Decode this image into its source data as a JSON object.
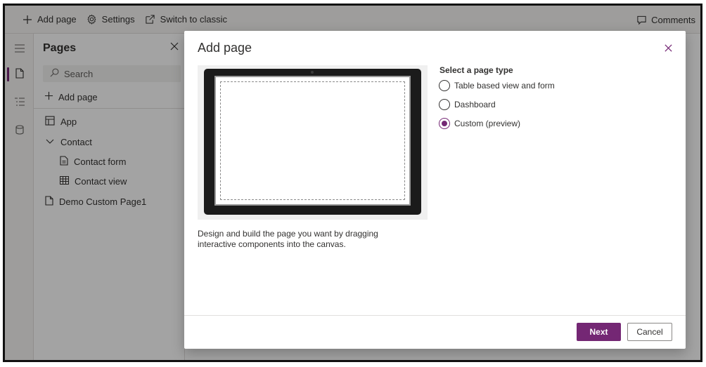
{
  "commandbar": {
    "add_page": "Add page",
    "settings": "Settings",
    "switch_classic": "Switch to classic",
    "comments": "Comments"
  },
  "pages_panel": {
    "title": "Pages",
    "search_placeholder": "Search",
    "add_page": "Add page",
    "items": [
      {
        "label": "App",
        "icon": "app-icon"
      },
      {
        "label": "Contact",
        "icon": "chevron-down-icon"
      },
      {
        "label": "Contact form",
        "icon": "form-icon"
      },
      {
        "label": "Contact view",
        "icon": "grid-icon"
      },
      {
        "label": "Demo Custom Page1",
        "icon": "page-icon"
      }
    ]
  },
  "dialog": {
    "title": "Add page",
    "description": "Design and build the page you want by dragging interactive components into the canvas.",
    "page_type_label": "Select a page type",
    "options": [
      {
        "label": "Table based view and form",
        "selected": false
      },
      {
        "label": "Dashboard",
        "selected": false
      },
      {
        "label": "Custom (preview)",
        "selected": true
      }
    ],
    "next_label": "Next",
    "cancel_label": "Cancel"
  },
  "colors": {
    "accent": "#742774",
    "overlay": "rgba(0,0,0,0.36)"
  }
}
